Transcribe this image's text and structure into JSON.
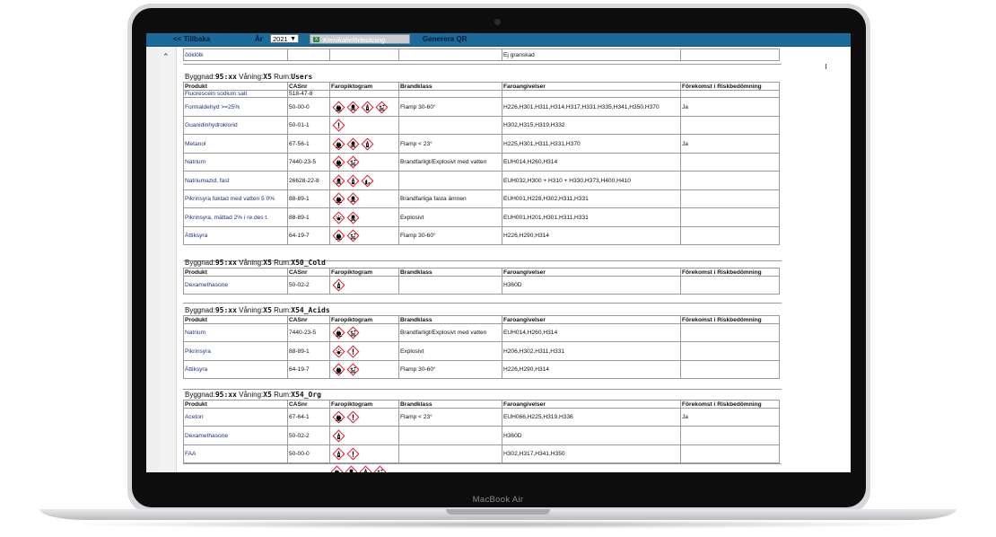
{
  "toolbar": {
    "back": "<< Tillbaka",
    "year_label": "År",
    "year_value": "2021",
    "kem_button": "Kemikalieförteckning",
    "qr_button": "Generera QR"
  },
  "top_fragment": {
    "product": "ööklölk",
    "status": "Ej granskad"
  },
  "columns": [
    "Produkt",
    "CASnr",
    "Faropiktogram",
    "Brandklass",
    "Faroangivelser",
    "Förekomst i Riskbedömning"
  ],
  "rooms": [
    {
      "prefix": "Byggnad:",
      "building": "95:xx",
      "floor_label": "Våning:",
      "floor": "X5",
      "room_label": "Rum:",
      "room": "Users",
      "rows": [
        {
          "product": "Fluorescein sodium salt",
          "cas": "518-47-8",
          "icons": [],
          "fire": "",
          "hazard": "",
          "risk": ""
        },
        {
          "product": "Formaldehyd >=25%",
          "cas": "50-00-0",
          "icons": [
            "flame-icon",
            "toxic-skull-icon",
            "health-hazard-icon",
            "corrosive-icon"
          ],
          "fire": "Flamp 30-60°",
          "hazard": "H226,H301,H311,H314,H317,H331,H335,H341,H350,H370",
          "risk": "Ja"
        },
        {
          "product": "Guanidinhydroklorid",
          "cas": "50-01-1",
          "icons": [
            "exclamation-icon"
          ],
          "fire": "",
          "hazard": "H302,H315,H319,H332",
          "risk": ""
        },
        {
          "product": "Metanol",
          "cas": "67-56-1",
          "icons": [
            "flame-icon",
            "toxic-skull-icon",
            "health-hazard-icon"
          ],
          "fire": "Flamp < 23°",
          "hazard": "H225,H301,H311,H331,H370",
          "risk": "Ja"
        },
        {
          "product": "Natrium",
          "cas": "7440-23-5",
          "icons": [
            "flame-icon",
            "corrosive-icon"
          ],
          "fire": "Brandfarligt/Explosivt med vatten",
          "hazard": "EUH014,H260,H314",
          "risk": ""
        },
        {
          "product": "Natriumazid, fast",
          "cas": "26628-22-8",
          "icons": [
            "toxic-skull-icon",
            "health-hazard-icon",
            "environment-icon"
          ],
          "fire": "",
          "hazard": "EUH032,H300 + H310 + H330,H373,H400,H410",
          "risk": ""
        },
        {
          "product": "Pikrinsyra fuktad med vatten 5 0%",
          "cas": "88-89-1",
          "icons": [
            "flame-icon",
            "toxic-skull-icon"
          ],
          "fire": "Brandfarliga fasta ämnen",
          "hazard": "EUH001,H228,H302,H311,H331",
          "risk": ""
        },
        {
          "product": "Pikrinsyra, mättad 2% i re.des t.",
          "cas": "88-89-1",
          "icons": [
            "explosive-icon",
            "toxic-skull-icon"
          ],
          "fire": "Explosivt",
          "hazard": "EUH001,H201,H301,H311,H331",
          "risk": ""
        },
        {
          "product": "Ättiksyra",
          "cas": "64-19-7",
          "icons": [
            "flame-icon",
            "corrosive-icon"
          ],
          "fire": "Flamp 30-60°",
          "hazard": "H226,H290,H314",
          "risk": ""
        }
      ]
    },
    {
      "prefix": "Byggnad:",
      "building": "95:xx",
      "floor_label": "Våning:",
      "floor": "X5",
      "room_label": "Rum:",
      "room": "X50_Cold",
      "rows": [
        {
          "product": "Dexamethasone",
          "cas": "50-02-2",
          "icons": [
            "health-hazard-icon"
          ],
          "fire": "",
          "hazard": "H360D",
          "risk": ""
        }
      ]
    },
    {
      "prefix": "Byggnad:",
      "building": "95:xx",
      "floor_label": "Våning:",
      "floor": "X5",
      "room_label": "Rum:",
      "room": "X54_Acids",
      "rows": [
        {
          "product": "Natrium",
          "cas": "7440-23-5",
          "icons": [
            "flame-icon",
            "corrosive-icon"
          ],
          "fire": "Brandfarligt/Explosivt med vatten",
          "hazard": "EUH014,H260,H314",
          "risk": ""
        },
        {
          "product": "Pikrinsyra",
          "cas": "88-89-1",
          "icons": [
            "explosive-icon",
            "exclamation-icon"
          ],
          "fire": "Explosivt",
          "hazard": "H206,H302,H311,H331",
          "risk": ""
        },
        {
          "product": "Ättiksyra",
          "cas": "64-19-7",
          "icons": [
            "flame-icon",
            "corrosive-icon"
          ],
          "fire": "Flamp 30-60°",
          "hazard": "H226,H290,H314",
          "risk": ""
        }
      ]
    },
    {
      "prefix": "Byggnad:",
      "building": "95:xx",
      "floor_label": "Våning:",
      "floor": "X5",
      "room_label": "Rum:",
      "room": "X54_Org",
      "rows": [
        {
          "product": "Aceton",
          "cas": "67-64-1",
          "icons": [
            "flame-icon",
            "exclamation-icon"
          ],
          "fire": "Flamp < 23°",
          "hazard": "EUH066,H225,H319,H336",
          "risk": "Ja"
        },
        {
          "product": "Dexamethasone",
          "cas": "50-02-2",
          "icons": [
            "health-hazard-icon"
          ],
          "fire": "",
          "hazard": "H360D",
          "risk": ""
        },
        {
          "product": "FAA",
          "cas": "50-00-0",
          "icons": [
            "health-hazard-icon",
            "exclamation-icon"
          ],
          "fire": "",
          "hazard": "H302,H317,H341,H350",
          "risk": ""
        }
      ]
    }
  ],
  "laptop_brand": "MacBook Air",
  "colors": {
    "toolbar": "#1a6b9a",
    "ghs_red": "#e3141b",
    "link": "#1d2f86"
  }
}
